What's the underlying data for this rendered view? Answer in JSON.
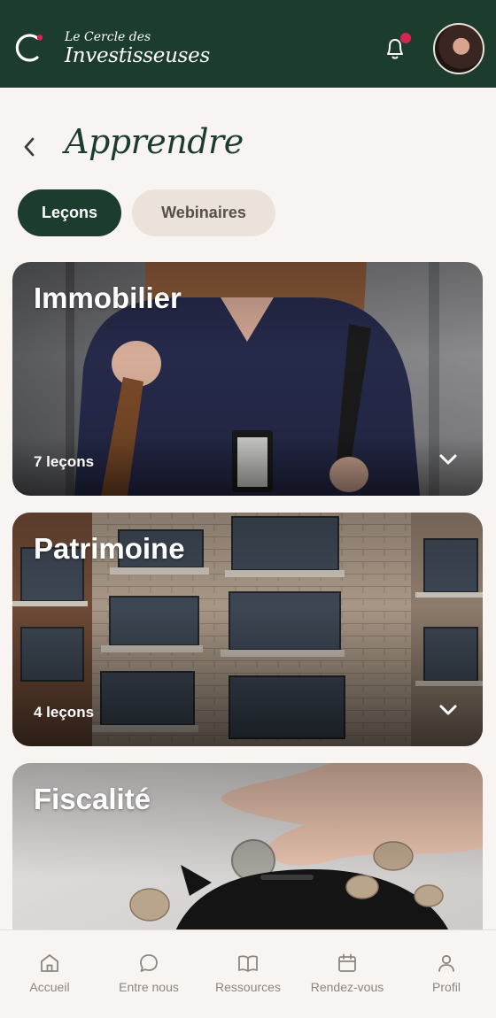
{
  "brand": {
    "line1": "Le Cercle des",
    "line2": "Investisseuses",
    "accent": "#d62550",
    "primary": "#1c3d2e"
  },
  "header": {
    "notification_icon": "bell-icon",
    "has_unread": true
  },
  "page": {
    "title": "Apprendre"
  },
  "tabs": [
    {
      "label": "Leçons",
      "active": true
    },
    {
      "label": "Webinaires",
      "active": false
    }
  ],
  "categories": [
    {
      "title": "Immobilier",
      "count": "7 leçons"
    },
    {
      "title": "Patrimoine",
      "count": "4 leçons"
    },
    {
      "title": "Fiscalité",
      "count": ""
    }
  ],
  "nav": [
    {
      "label": "Accueil",
      "icon": "home-icon"
    },
    {
      "label": "Entre nous",
      "icon": "chat-icon"
    },
    {
      "label": "Ressources",
      "icon": "book-icon"
    },
    {
      "label": "Rendez-vous",
      "icon": "calendar-icon"
    },
    {
      "label": "Profil",
      "icon": "user-icon"
    }
  ]
}
